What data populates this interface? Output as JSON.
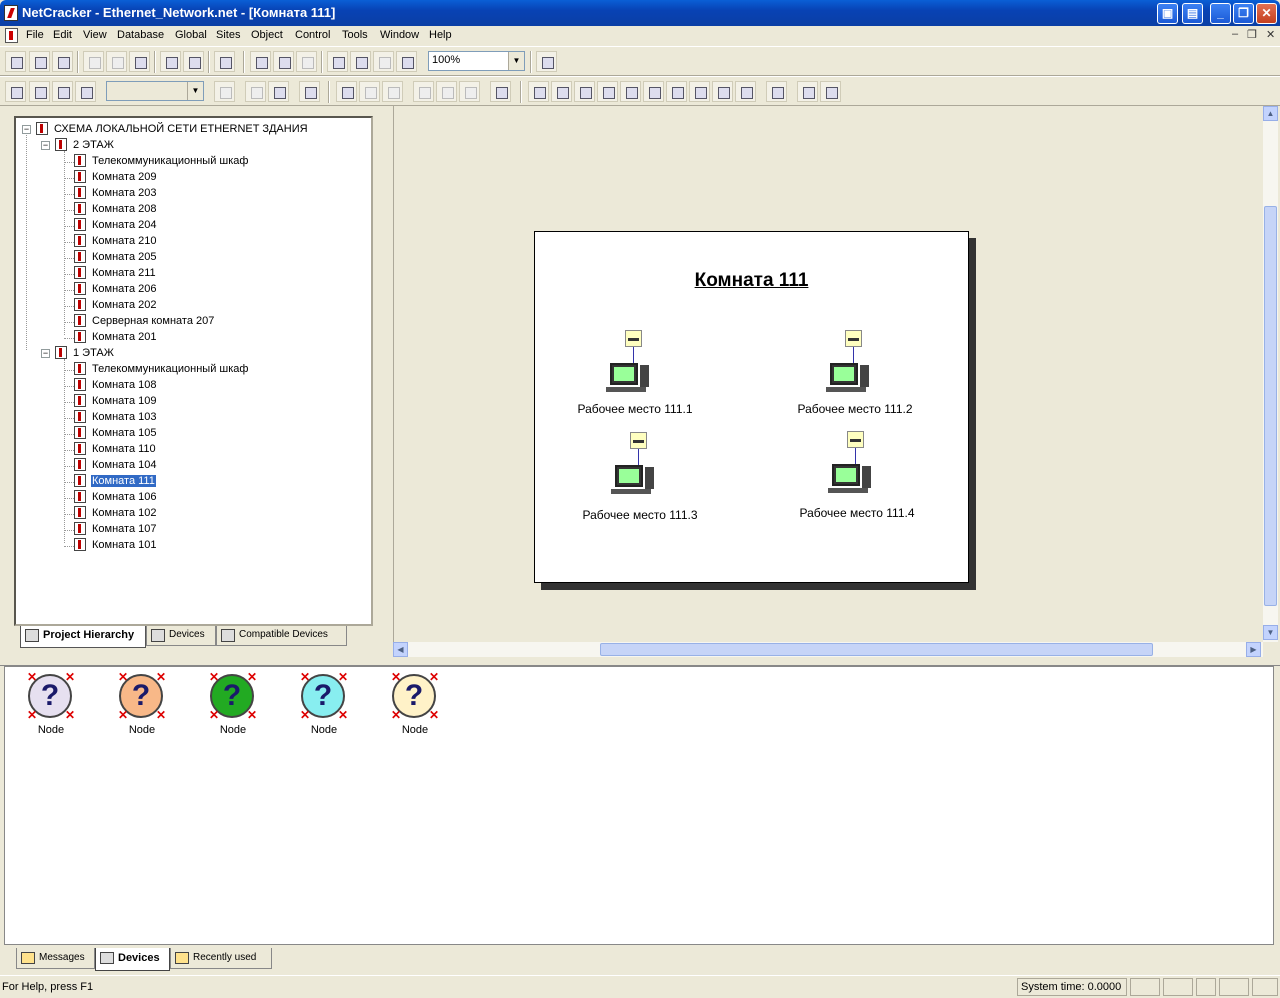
{
  "window": {
    "title": "NetCracker - Ethernet_Network.net - [Комната 111]"
  },
  "menu": [
    "File",
    "Edit",
    "View",
    "Database",
    "Global",
    "Sites",
    "Object",
    "Control",
    "Tools",
    "Window",
    "Help"
  ],
  "toolbar": {
    "zoom_value": "100%"
  },
  "tree": {
    "root": "СХЕМА ЛОКАЛЬНОЙ СЕТИ ETHERNET ЗДАНИЯ",
    "floor2": {
      "label": "2 ЭТАЖ",
      "items": [
        "Телекоммуникационный шкаф",
        "Комната 209",
        "Комната 203",
        "Комната 208",
        "Комната 204",
        "Комната 210",
        "Комната 205",
        "Комната 211",
        "Комната 206",
        "Комната 202",
        "Серверная комната 207",
        "Комната 201"
      ]
    },
    "floor1": {
      "label": "1 ЭТАЖ",
      "items": [
        "Телекоммуникационный шкаф",
        "Комната 108",
        "Комната 109",
        "Комната 103",
        "Комната 105",
        "Комната 110",
        "Комната 104",
        "Комната 111",
        "Комната 106",
        "Комната 102",
        "Комната 107",
        "Комната 101"
      ]
    },
    "selected": "Комната 111"
  },
  "panel_tabs": [
    "Project Hierarchy",
    "Devices",
    "Compatible Devices"
  ],
  "sheet": {
    "title": "Комната 111",
    "workstations": [
      "Рабочее место 111.1",
      "Рабочее место 111.2",
      "Рабочее место 111.3",
      "Рабочее место 111.4"
    ]
  },
  "devices": [
    {
      "label": "Node",
      "color": "#e6e0f0"
    },
    {
      "label": "Node",
      "color": "#f8b888"
    },
    {
      "label": "Node",
      "color": "#22aa22"
    },
    {
      "label": "Node",
      "color": "#88eef0"
    },
    {
      "label": "Node",
      "color": "#fff2c8"
    }
  ],
  "bottom_tabs": [
    "Messages",
    "Devices",
    "Recently used"
  ],
  "status": {
    "help": "For Help, press F1",
    "system_time": "System time: 0.0000"
  }
}
